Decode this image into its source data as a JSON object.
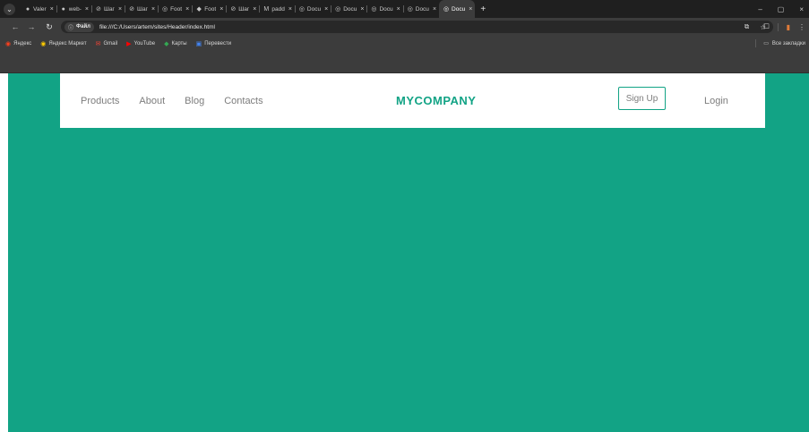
{
  "browser": {
    "tabs": [
      {
        "icon": "github-icon",
        "glyph": "●",
        "title": "Valer"
      },
      {
        "icon": "github-icon",
        "glyph": "●",
        "title": "web-"
      },
      {
        "icon": "shag-icon",
        "glyph": "⊘",
        "title": "Шаг"
      },
      {
        "icon": "shag-icon",
        "glyph": "⊘",
        "title": "Шаг"
      },
      {
        "icon": "globe-icon",
        "glyph": "◎",
        "title": "Foot"
      },
      {
        "icon": "figma-icon",
        "glyph": "◆",
        "title": "Foot"
      },
      {
        "icon": "shag-icon",
        "glyph": "⊘",
        "title": "Шаг"
      },
      {
        "icon": "mdn-icon",
        "glyph": "M",
        "title": "padd"
      },
      {
        "icon": "globe-icon",
        "glyph": "◎",
        "title": "Docu"
      },
      {
        "icon": "globe-icon",
        "glyph": "◎",
        "title": "Docu"
      },
      {
        "icon": "globe-icon",
        "glyph": "◎",
        "title": "Docu"
      },
      {
        "icon": "globe-icon",
        "glyph": "◎",
        "title": "Docu"
      },
      {
        "icon": "globe-icon",
        "glyph": "◎",
        "title": "Docu",
        "active": true
      }
    ],
    "tab_close_glyph": "×",
    "new_tab_glyph": "+",
    "window_controls": [
      "–",
      "▢",
      "×"
    ],
    "site_info_label": "Файл",
    "url": "file:///C:/Users/artem/sites/Header/index.html",
    "bookmarks": [
      {
        "label": "Яндекс",
        "icon": "yandex-icon",
        "glyph": "◉",
        "cls": "ico-yandex"
      },
      {
        "label": "Яндекс Маркет",
        "icon": "market-icon",
        "glyph": "◉",
        "cls": "ico-market"
      },
      {
        "label": "Gmail",
        "icon": "gmail-icon",
        "glyph": "✉",
        "cls": "ico-gmail"
      },
      {
        "label": "YouTube",
        "icon": "youtube-icon",
        "glyph": "▶",
        "cls": "ico-youtube"
      },
      {
        "label": "Карты",
        "icon": "maps-icon",
        "glyph": "◆",
        "cls": "ico-maps"
      },
      {
        "label": "Перевести",
        "icon": "translate-icon",
        "glyph": "▣",
        "cls": "ico-translate"
      }
    ],
    "all_bookmarks_label": "Все закладки"
  },
  "site": {
    "nav": [
      "Products",
      "About",
      "Blog",
      "Contacts"
    ],
    "logo": "MYCOMPANY",
    "signup": "Sign Up",
    "login": "Login"
  },
  "colors": {
    "brand": "#12a385",
    "chrome_dark": "#1f1f1f",
    "chrome_toolbar": "#3c3c3c"
  }
}
